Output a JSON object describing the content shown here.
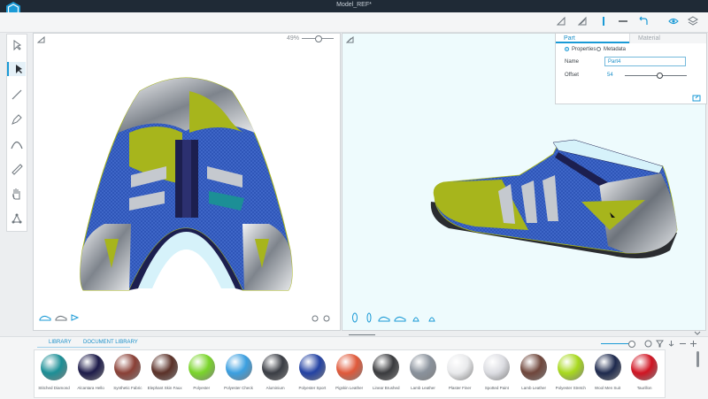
{
  "app": {
    "title": "Model_REF*"
  },
  "viewport2d": {
    "zoom_label": "49%"
  },
  "properties_panel": {
    "tabs": [
      "Part",
      "Material"
    ],
    "radios": [
      "Properties",
      "Metadata"
    ],
    "name_label": "Name",
    "name_value": "Part4",
    "offset_label": "Offset",
    "offset_value": "54"
  },
  "library": {
    "tabs": [
      "LIBRARY",
      "DOCUMENT LIBRARY"
    ],
    "materials": [
      {
        "name": "Stitched Diamond",
        "color": "#1c8f96"
      },
      {
        "name": "Alcantara Hello",
        "color": "#1d1b4a"
      },
      {
        "name": "Synthetic Fabric",
        "color": "#8a4036"
      },
      {
        "name": "Elephant Skin Faux",
        "color": "#5b3128"
      },
      {
        "name": "Polyester",
        "color": "#7ad52a"
      },
      {
        "name": "Polyester Check",
        "color": "#3b9fe0"
      },
      {
        "name": "Aluminium",
        "color": "#3a3d44"
      },
      {
        "name": "Polyester Sport",
        "color": "#2342a3"
      },
      {
        "name": "Pigskin Leather",
        "color": "#e0593a"
      },
      {
        "name": "Linear Brushed",
        "color": "#3a3b3e"
      },
      {
        "name": "Lamb Leather",
        "color": "#8a929c"
      },
      {
        "name": "Plaster Finer",
        "color": "#e9eaec"
      },
      {
        "name": "Spotted Paint",
        "color": "#dcdde2"
      },
      {
        "name": "Lamb Leather",
        "color": "#6f463b"
      },
      {
        "name": "Polyester Stretch",
        "color": "#a8d91e"
      },
      {
        "name": "Wool Men Suit",
        "color": "#1e2a4e"
      },
      {
        "name": "Taurillon",
        "color": "#d01422"
      }
    ]
  },
  "colors": {
    "accent": "#1a9ad6",
    "titlebar": "#1f2a36",
    "mesh_blue": "#2f56b8",
    "lime": "#a7b51c",
    "navy": "#1c1f4f"
  }
}
